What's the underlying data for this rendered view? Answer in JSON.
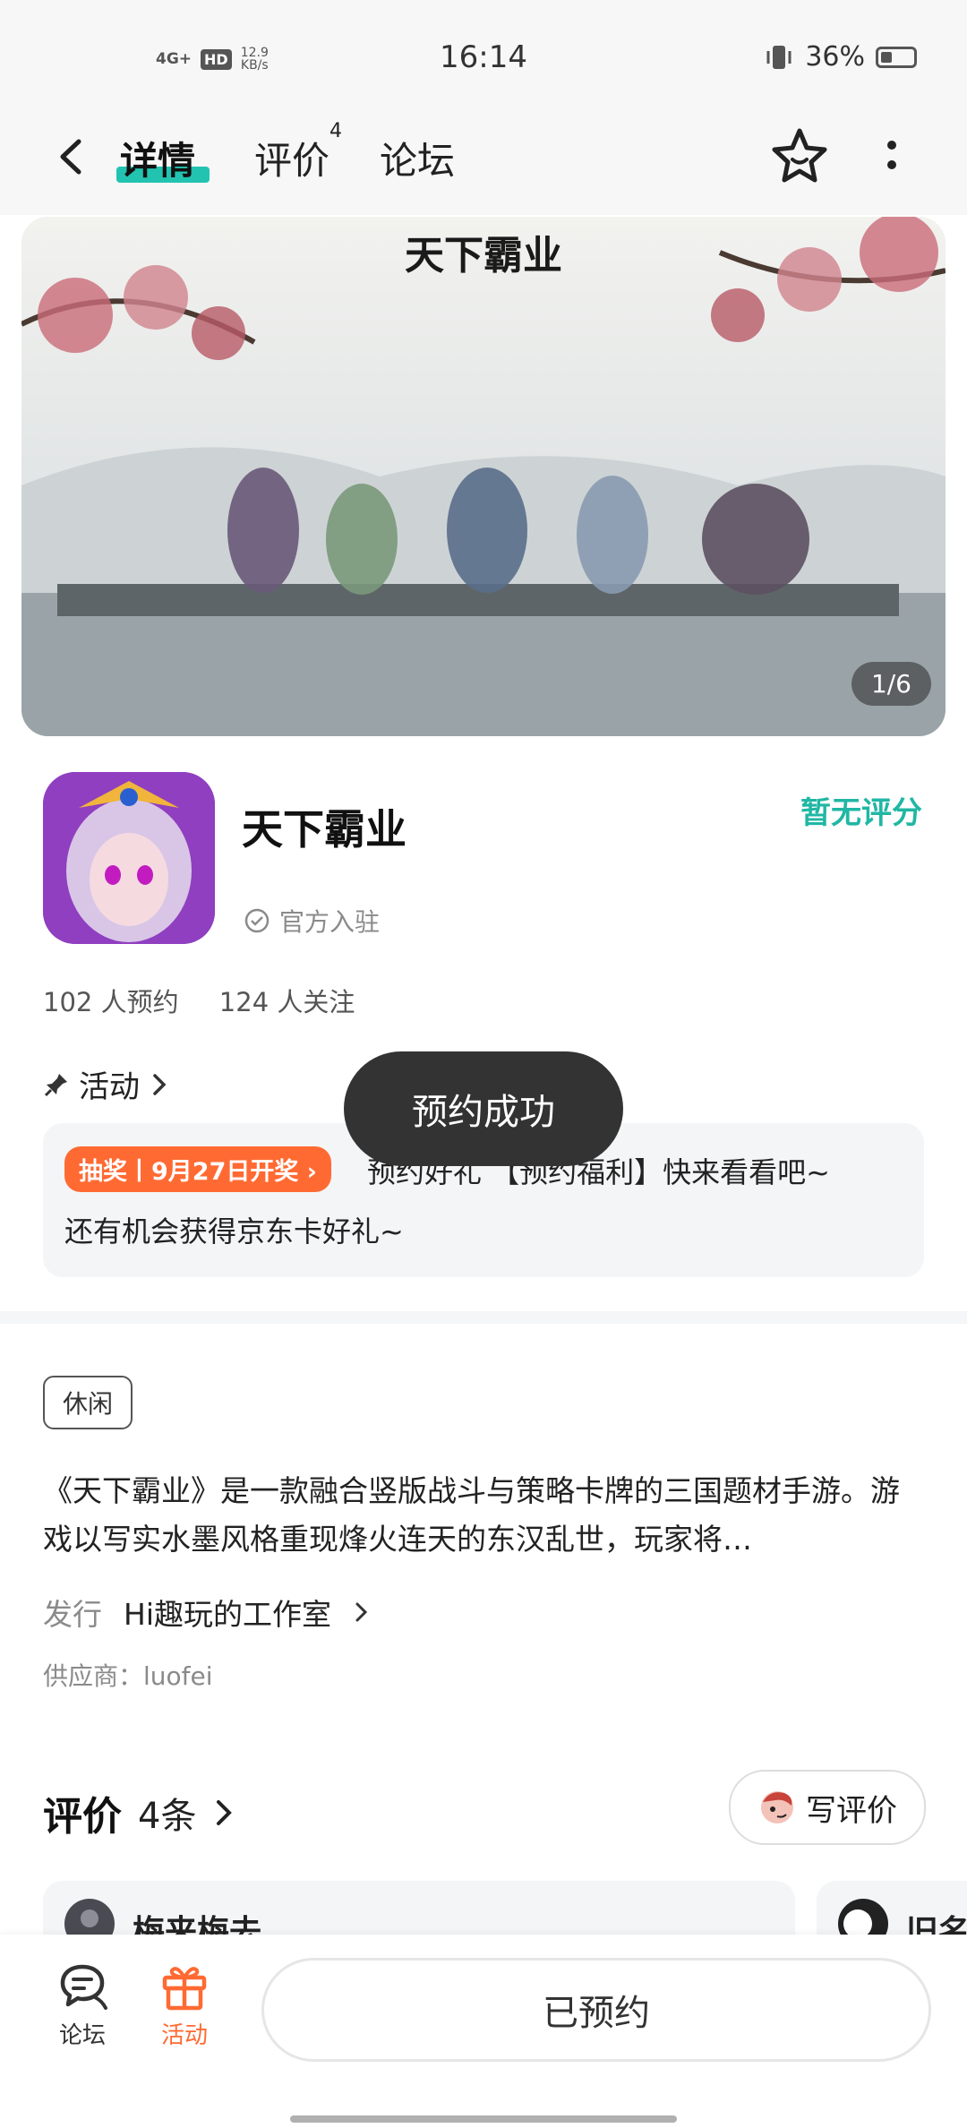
{
  "status_bar": {
    "signal": "4G+",
    "hd": "HD",
    "net_speed_value": "12.9",
    "net_speed_unit": "KB/s",
    "time": "16:14",
    "battery": "36%"
  },
  "nav": {
    "tabs": [
      {
        "label": "详情",
        "active": true
      },
      {
        "label": "评价",
        "badge": "4"
      },
      {
        "label": "论坛"
      }
    ]
  },
  "banner": {
    "title_art": "天下霸业",
    "pager": "1/6"
  },
  "game": {
    "name": "天下霸业",
    "verified": "官方入驻",
    "rating": "暂无评分",
    "reservations": "102 人预约",
    "followers": "124 人关注"
  },
  "activity": {
    "header": "活动",
    "badge": "抽奖丨9月27日开奖",
    "line1": "预约好礼 【预约福利】快来看看吧~",
    "line2": "还有机会获得京东卡好礼~"
  },
  "toast": "预约成功",
  "details": {
    "tag": "休闲",
    "description": "《天下霸业》是一款融合竖版战斗与策略卡牌的三国题材手游。游戏以写实水墨风格重现烽火连天的东汉乱世，玩家将…",
    "publisher_key": "发行",
    "publisher_value": "Hi趣玩的工作室",
    "supplier": "供应商：luofei"
  },
  "reviews": {
    "title": "评价",
    "count": "4条",
    "write_button": "写评价",
    "card1_name": "梅来梅去",
    "card2_name": "旧名"
  },
  "bottom": {
    "forum_label": "论坛",
    "activity_label": "活动",
    "reserved_button": "已预约"
  },
  "colors": {
    "accent": "#22c3b0",
    "activity_orange": "#ff6a33"
  }
}
